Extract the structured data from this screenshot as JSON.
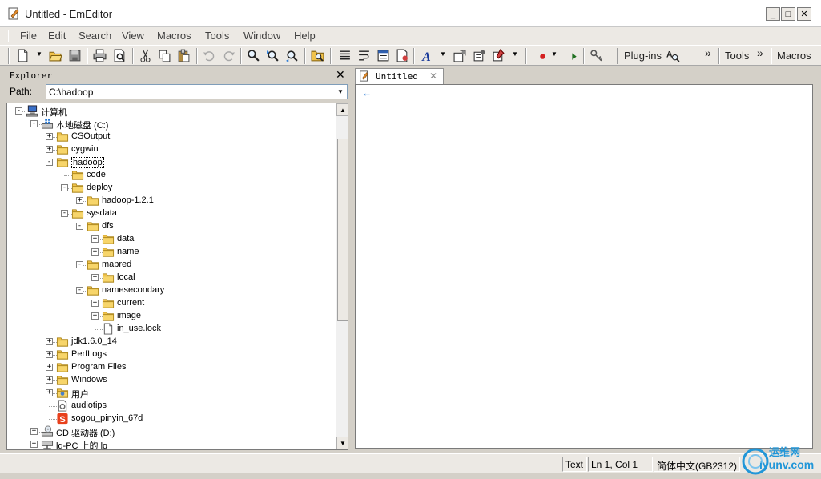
{
  "window": {
    "title": "Untitled - EmEditor",
    "min_glyph": "_",
    "max_glyph": "□",
    "close_glyph": "✕"
  },
  "menu": {
    "items": [
      "File",
      "Edit",
      "Search",
      "View",
      "Macros",
      "Tools",
      "Window",
      "Help"
    ]
  },
  "toolbar": {
    "plugins_label": "Plug-ins",
    "tools_label": "Tools",
    "macros_label": "Macros",
    "overflow_glyph": "»"
  },
  "explorer": {
    "title": "Explorer",
    "close_glyph": "✕",
    "path_label": "Path:",
    "path_value": "C:\\hadoop",
    "tree": [
      {
        "label": "计算机",
        "icon": "computer-icon",
        "exp": "-"
      },
      {
        "label": "本地磁盘 (C:)",
        "icon": "drive-icon",
        "exp": "-"
      },
      {
        "label": "CSOutput",
        "icon": "folder-icon",
        "exp": "+"
      },
      {
        "label": "cygwin",
        "icon": "folder-icon",
        "exp": "+"
      },
      {
        "label": "hadoop",
        "icon": "folder-icon",
        "exp": "-",
        "selected": true
      },
      {
        "label": "code",
        "icon": "folder-icon",
        "exp": ""
      },
      {
        "label": "deploy",
        "icon": "folder-icon",
        "exp": "-"
      },
      {
        "label": "hadoop-1.2.1",
        "icon": "folder-icon",
        "exp": "+"
      },
      {
        "label": "sysdata",
        "icon": "folder-icon",
        "exp": "-"
      },
      {
        "label": "dfs",
        "icon": "folder-icon",
        "exp": "-"
      },
      {
        "label": "data",
        "icon": "folder-icon",
        "exp": "+"
      },
      {
        "label": "name",
        "icon": "folder-icon",
        "exp": "+"
      },
      {
        "label": "mapred",
        "icon": "folder-icon",
        "exp": "-"
      },
      {
        "label": "local",
        "icon": "folder-icon",
        "exp": "+"
      },
      {
        "label": "namesecondary",
        "icon": "folder-icon",
        "exp": "-"
      },
      {
        "label": "current",
        "icon": "folder-icon",
        "exp": "+"
      },
      {
        "label": "image",
        "icon": "folder-icon",
        "exp": "+"
      },
      {
        "label": "in_use.lock",
        "icon": "file-icon",
        "exp": ""
      },
      {
        "label": "jdk1.6.0_14",
        "icon": "folder-icon",
        "exp": "+"
      },
      {
        "label": "PerfLogs",
        "icon": "folder-icon",
        "exp": "+"
      },
      {
        "label": "Program Files",
        "icon": "folder-icon",
        "exp": "+"
      },
      {
        "label": "Windows",
        "icon": "folder-icon",
        "exp": "+"
      },
      {
        "label": "用户",
        "icon": "users-folder-icon",
        "exp": "+"
      },
      {
        "label": "audiotips",
        "icon": "settings-file-icon",
        "exp": ""
      },
      {
        "label": "sogou_pinyin_67d",
        "icon": "sogou-icon",
        "exp": ""
      },
      {
        "label": "CD 驱动器 (D:)",
        "icon": "cd-drive-icon",
        "exp": "+"
      },
      {
        "label": "lg-PC 上的 lg",
        "icon": "network-drive-icon",
        "exp": "+"
      }
    ]
  },
  "editor": {
    "tab_label": "Untitled",
    "tab_close_glyph": "✕",
    "caret_glyph": "←"
  },
  "status": {
    "mode": "Text",
    "position": "Ln 1, Col 1",
    "encoding": "简体中文(GB2312)"
  },
  "watermark": {
    "line1": "运维网",
    "line2": "iyunv.com"
  },
  "colors": {
    "folder": "#f0c24a",
    "accent": "#2a7bd6",
    "watermark": "#2196d8"
  }
}
